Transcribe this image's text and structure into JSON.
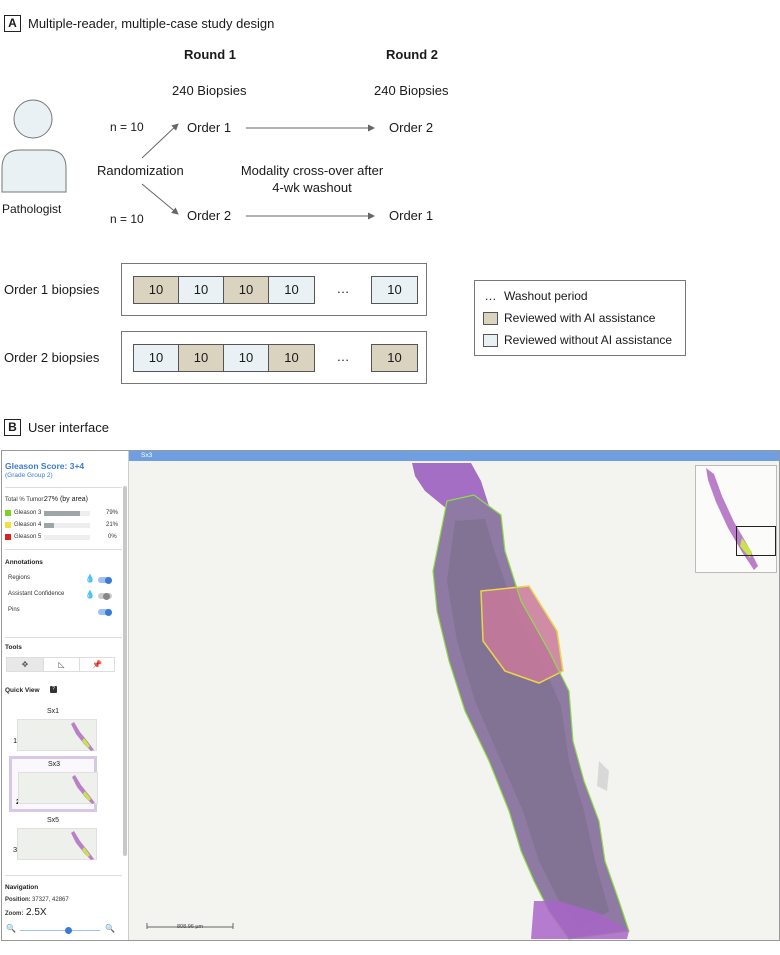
{
  "panel_a": {
    "letter": "A",
    "title": "Multiple-reader, multiple-case study design",
    "round1": {
      "label": "Round 1",
      "biopsies": "240 Biopsies"
    },
    "round2": {
      "label": "Round 2",
      "biopsies": "240 Biopsies"
    },
    "pathologist_label": "Pathologist",
    "randomization_label": "Randomization",
    "n_top": "n = 10",
    "n_bottom": "n = 10",
    "order1": "Order 1",
    "order2": "Order 2",
    "order1_r2": "Order 2",
    "order2_r2": "Order 1",
    "crossover_line1": "Modality cross-over after",
    "crossover_line2": "4-wk washout",
    "order1_biopsies_label": "Order 1 biopsies",
    "order2_biopsies_label": "Order 2 biopsies",
    "order1_cells": [
      {
        "value": "10",
        "type": "ai"
      },
      {
        "value": "10",
        "type": "noai"
      },
      {
        "value": "10",
        "type": "ai"
      },
      {
        "value": "10",
        "type": "noai"
      },
      {
        "value": "…",
        "type": "gap"
      },
      {
        "value": "10",
        "type": "noai"
      }
    ],
    "order2_cells": [
      {
        "value": "10",
        "type": "noai"
      },
      {
        "value": "10",
        "type": "ai"
      },
      {
        "value": "10",
        "type": "noai"
      },
      {
        "value": "10",
        "type": "ai"
      },
      {
        "value": "…",
        "type": "gap"
      },
      {
        "value": "10",
        "type": "ai"
      }
    ],
    "legend": {
      "washout_symbol": "…",
      "washout": "Washout period",
      "with_ai": "Reviewed with AI assistance",
      "without_ai": "Reviewed without AI assistance"
    },
    "colors": {
      "with_ai": "#d9d3c0",
      "without_ai": "#e9f1f4"
    }
  },
  "panel_b": {
    "letter": "B",
    "title": "User interface",
    "viewer_tab": "Sx3",
    "gleason_score": "Gleason Score:  3+4",
    "grade_group": "(Grade Group 2)",
    "total_tumor_label": "Total % Tumor:",
    "total_tumor_value": "27% (by area)",
    "gleason_rows": [
      {
        "label": "Gleason 3",
        "pct": "79%",
        "fraction": 0.79,
        "color": "#7ed321"
      },
      {
        "label": "Gleason 4",
        "pct": "21%",
        "fraction": 0.21,
        "color": "#f0e23c"
      },
      {
        "label": "Gleason 5",
        "pct": "0%",
        "fraction": 0.0,
        "color": "#e02020"
      }
    ],
    "annotations_title": "Annotations",
    "annotations": [
      {
        "label": "Regions",
        "on": true,
        "has_drop": true
      },
      {
        "label": "Assistant Confidence",
        "on": false,
        "has_drop": true
      },
      {
        "label": "Pins",
        "on": true,
        "has_drop": false
      }
    ],
    "tools_title": "Tools",
    "tools": [
      "move-icon",
      "measure-icon",
      "pin-icon"
    ],
    "quick_view_title": "Quick View",
    "quick_view_help": "?",
    "quick_views": [
      {
        "name": "Sx1",
        "index": "1",
        "selected": false
      },
      {
        "name": "Sx3",
        "index": "2",
        "selected": true
      },
      {
        "name": "Sx5",
        "index": "3",
        "selected": false
      }
    ],
    "navigation_title": "Navigation",
    "position_label": "Position:",
    "position_value": "37327, 42867",
    "zoom_label": "Zoom:",
    "zoom_value": "2.5X",
    "zoom_slider_fraction": 0.6,
    "scale_bar": "808.96 µm",
    "accent": "#3a7bd5"
  }
}
